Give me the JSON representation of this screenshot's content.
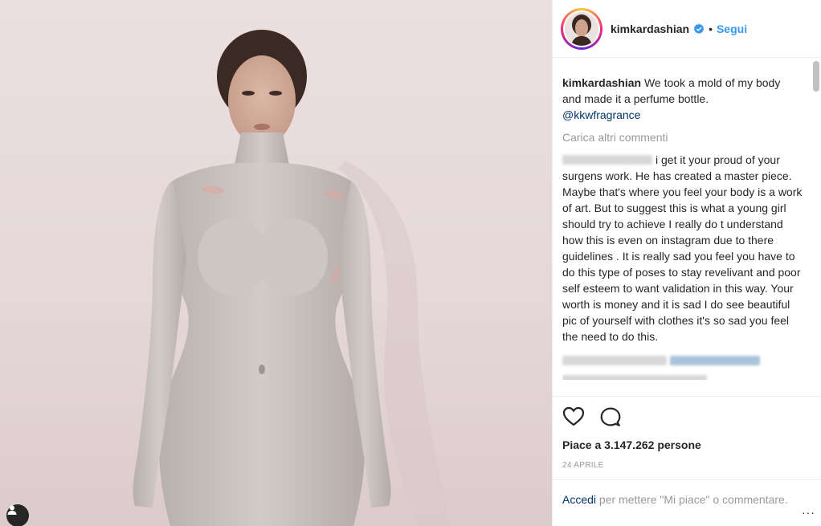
{
  "post": {
    "username": "kimkardashian",
    "follow_label": "Segui",
    "separator": "•",
    "caption_user": "kimkardashian",
    "caption_text": "We took a mold of my body and made it a perfume bottle.",
    "caption_mention": "@kkwfragrance",
    "load_more_label": "Carica altri commenti",
    "comment2_text": "i get it your proud of your surgens work. He has created a master piece. Maybe that's where you feel your body is a work of art. But to suggest this is what a young girl should try to achieve I really do t understand how this is even on instagram due to there guidelines . It is really sad you feel you have to do this type of poses to stay revelivant and poor self esteem to want validation in this way. Your worth is money and it is sad I do see beautiful pic of yourself with clothes it's so sad you feel the need to do this.",
    "likes_text": "Piace a 3.147.262 persone",
    "date_text": "24 aprile",
    "login_link": "Accedi",
    "login_text": " per mettere \"Mi piace\" o commentare.",
    "more_options": "···"
  },
  "icons": {
    "like": "heart-icon",
    "comment": "comment-icon",
    "verified": "verified-badge-icon",
    "user_tag": "user-tag-icon"
  },
  "colors": {
    "link_blue": "#3897f0",
    "mention_blue": "#003569",
    "muted": "#999999",
    "text": "#262626"
  }
}
